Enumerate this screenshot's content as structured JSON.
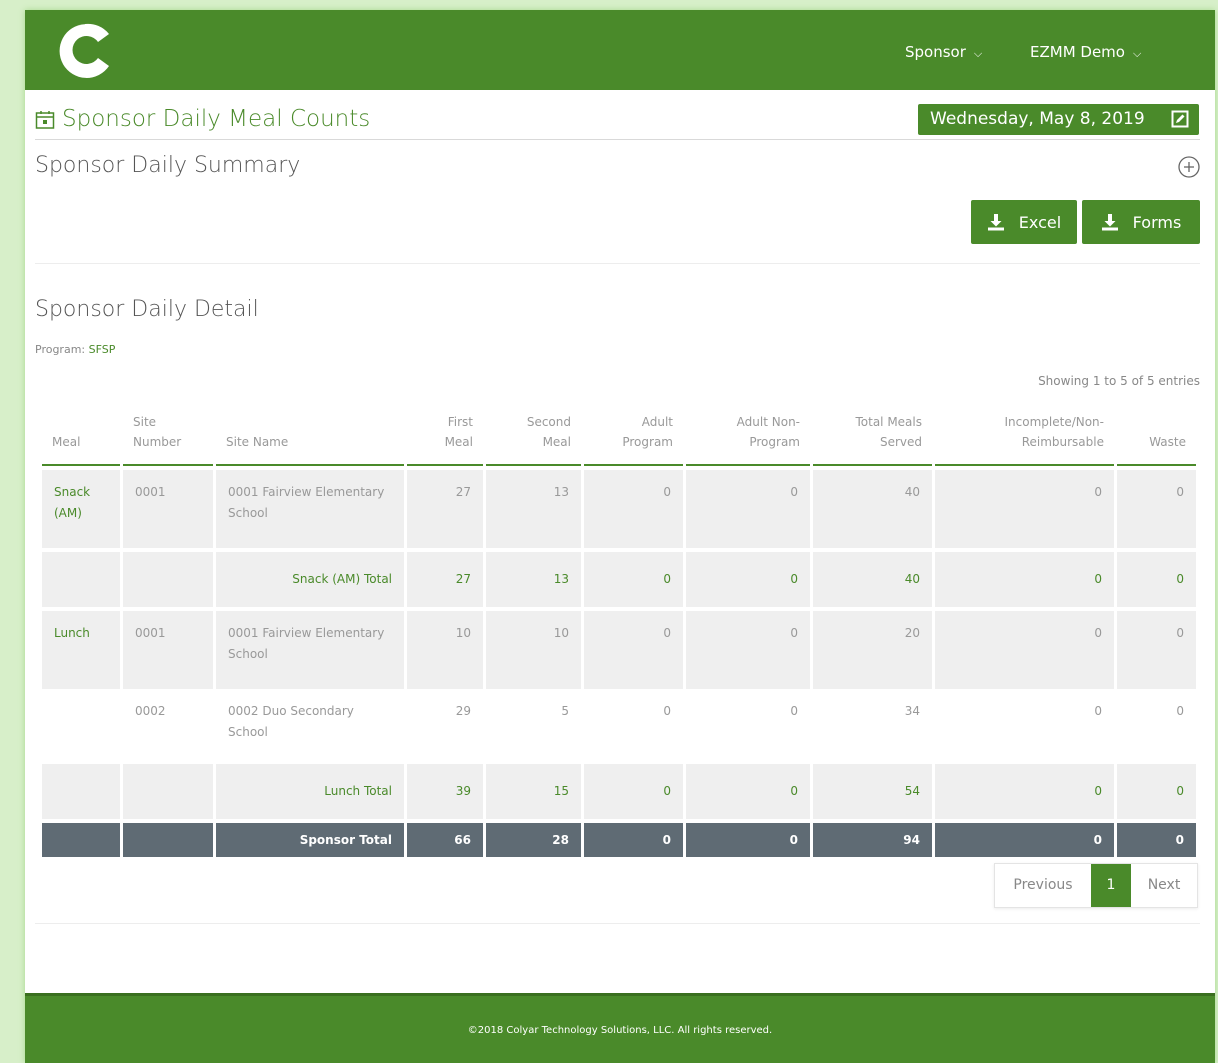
{
  "header": {
    "nav_sponsor": "Sponsor",
    "nav_user": "EZMM Demo"
  },
  "page": {
    "title": "Sponsor Daily Meal Counts",
    "date": "Wednesday, May 8, 2019"
  },
  "summary": {
    "title": "Sponsor Daily Summary",
    "excel_label": "Excel",
    "forms_label": "Forms"
  },
  "detail": {
    "title": "Sponsor Daily Detail",
    "program_label": "Program:",
    "program_value": "SFSP",
    "showing": "Showing 1 to 5 of 5 entries"
  },
  "table": {
    "headers": [
      "Meal",
      "Site Number",
      "Site Name",
      "First Meal",
      "Second Meal",
      "Adult Program",
      "Adult Non-Program",
      "Total Meals Served",
      "Incomplete/Non-Reimbursable",
      "Waste"
    ],
    "rows": [
      {
        "meal": "Snack (AM)",
        "site_number": "0001",
        "site_name": "0001 Fairview Elementary School",
        "first": "27",
        "second": "13",
        "adult": "0",
        "adult_non": "0",
        "total": "40",
        "incomplete": "0",
        "waste": "0"
      },
      {
        "subtotal_label": "Snack (AM) Total",
        "first": "27",
        "second": "13",
        "adult": "0",
        "adult_non": "0",
        "total": "40",
        "incomplete": "0",
        "waste": "0"
      },
      {
        "meal": "Lunch",
        "site_number": "0001",
        "site_name": "0001 Fairview Elementary School",
        "first": "10",
        "second": "10",
        "adult": "0",
        "adult_non": "0",
        "total": "20",
        "incomplete": "0",
        "waste": "0"
      },
      {
        "meal": "",
        "site_number": "0002",
        "site_name": "0002 Duo Secondary School",
        "first": "29",
        "second": "5",
        "adult": "0",
        "adult_non": "0",
        "total": "34",
        "incomplete": "0",
        "waste": "0"
      },
      {
        "subtotal_label": "Lunch Total",
        "first": "39",
        "second": "15",
        "adult": "0",
        "adult_non": "0",
        "total": "54",
        "incomplete": "0",
        "waste": "0"
      },
      {
        "total_label": "Sponsor Total",
        "first": "66",
        "second": "28",
        "adult": "0",
        "adult_non": "0",
        "total": "94",
        "incomplete": "0",
        "waste": "0"
      }
    ]
  },
  "pagination": {
    "previous": "Previous",
    "current": "1",
    "next": "Next"
  },
  "footer": {
    "copyright": "©2018 Colyar Technology Solutions, LLC. All rights reserved."
  },
  "colors": {
    "brand_green": "#4a8a2a",
    "total_row": "#5f6b74"
  }
}
